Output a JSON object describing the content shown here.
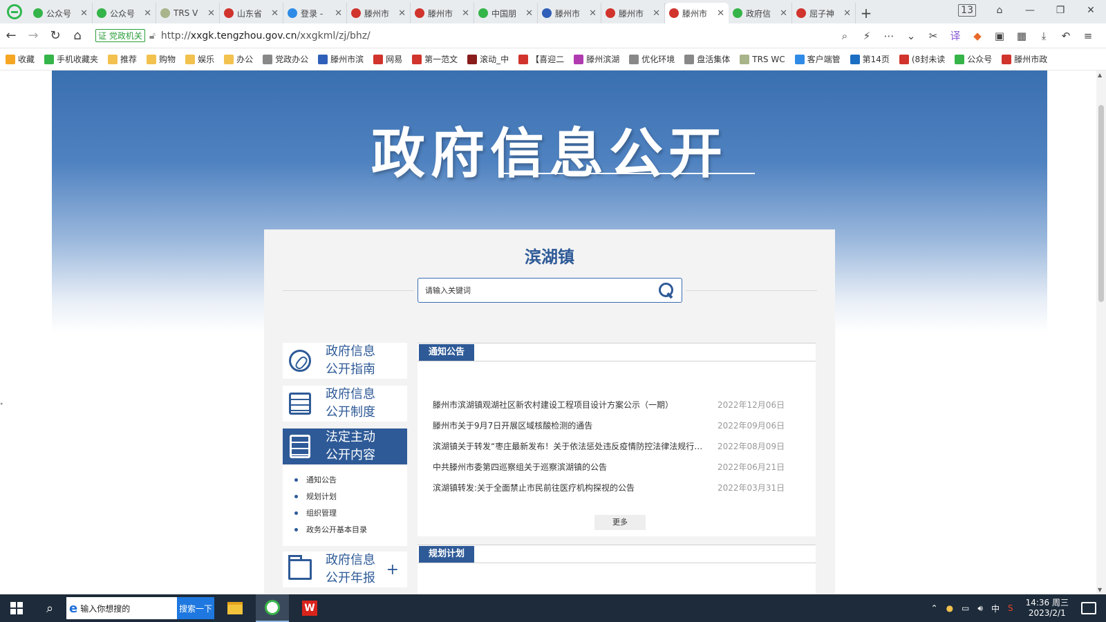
{
  "browser": {
    "tabs": [
      {
        "label": "公众号",
        "color": "#35b449"
      },
      {
        "label": "公众号",
        "color": "#35b449"
      },
      {
        "label": "TRS V",
        "color": "#a8b48a"
      },
      {
        "label": "山东省",
        "color": "#d0342c"
      },
      {
        "label": "登录 -",
        "color": "#2f8be6"
      },
      {
        "label": "滕州市",
        "color": "#d0342c"
      },
      {
        "label": "滕州市",
        "color": "#d0342c"
      },
      {
        "label": "中国朋",
        "color": "#35b449"
      },
      {
        "label": "滕州市",
        "color": "#2f5fb8"
      },
      {
        "label": "滕州市",
        "color": "#d0342c"
      },
      {
        "label": "滕州市",
        "color": "#d0342c"
      },
      {
        "label": "政府信",
        "color": "#35b449"
      },
      {
        "label": "屈子神",
        "color": "#d0342c"
      }
    ],
    "active_tab_index": 10,
    "tab_count": "13",
    "new_tab": "+",
    "address": {
      "badge": "证 党政机关",
      "url_prefix": "http://",
      "url_host": "xxgk.tengzhou.gov.cn",
      "url_path": "/xxgkml/zj/bhz/"
    },
    "bookmarks": [
      {
        "label": "收藏",
        "color": "#f5a623"
      },
      {
        "label": "手机收藏夹",
        "color": "#35b449"
      },
      {
        "label": "推荐",
        "color": "#f2c14e"
      },
      {
        "label": "购物",
        "color": "#f2c14e"
      },
      {
        "label": "娱乐",
        "color": "#f2c14e"
      },
      {
        "label": "办公",
        "color": "#f2c14e"
      },
      {
        "label": "党政办公",
        "color": "#888888"
      },
      {
        "label": "滕州市滨",
        "color": "#2f5fb8"
      },
      {
        "label": "网易",
        "color": "#d0342c"
      },
      {
        "label": "第一范文",
        "color": "#d0342c"
      },
      {
        "label": "滚动_中",
        "color": "#8a1c1c"
      },
      {
        "label": "【喜迎二",
        "color": "#d0342c"
      },
      {
        "label": "滕州滨湖",
        "color": "#b03ab0"
      },
      {
        "label": "优化环境",
        "color": "#888888"
      },
      {
        "label": "盘活集体",
        "color": "#888888"
      },
      {
        "label": "TRS WC",
        "color": "#a8b48a"
      },
      {
        "label": "客户端管",
        "color": "#2f8be6"
      },
      {
        "label": "第14页",
        "color": "#1b6ec2"
      },
      {
        "label": "(8封未读",
        "color": "#d0342c"
      },
      {
        "label": "公众号",
        "color": "#35b449"
      },
      {
        "label": "滕州市政",
        "color": "#d0342c"
      }
    ]
  },
  "page": {
    "banner_title": "政府信息公开",
    "town_title": "滨湖镇",
    "search_placeholder": "请输入关键词",
    "menu": [
      {
        "line1": "政府信息",
        "line2": "公开指南",
        "icon": "compass-icon"
      },
      {
        "line1": "政府信息",
        "line2": "公开制度",
        "icon": "list-icon"
      },
      {
        "line1": "法定主动",
        "line2": "公开内容",
        "icon": "document-icon"
      },
      {
        "line1": "政府信息",
        "line2": "公开年报",
        "icon": "folder-icon"
      }
    ],
    "active_menu_index": 2,
    "submenu": [
      "通知公告",
      "规划计划",
      "组织管理",
      "政务公开基本目录"
    ],
    "notice_panel": {
      "title": "通知公告",
      "items": [
        {
          "title": "滕州市滨湖镇观湖社区新农村建设工程项目设计方案公示（一期）",
          "date": "2022年12月06日"
        },
        {
          "title": "滕州市关于9月7日开展区域核酸检测的通告",
          "date": "2022年09月06日"
        },
        {
          "title": "滨湖镇关于转发“枣庄最新发布！关于依法惩处违反疫情防控法律法规行为的通告”",
          "date": "2022年08月09日"
        },
        {
          "title": "中共滕州市委第四巡察组关于巡察滨湖镇的公告",
          "date": "2022年06月21日"
        },
        {
          "title": "滨湖镇转发:关于全面禁止市民前往医疗机构探视的公告",
          "date": "2022年03月31日"
        }
      ],
      "more_label": "更多"
    },
    "plan_panel": {
      "title": "规划计划"
    }
  },
  "taskbar": {
    "search_input": "输入你想搜的",
    "search_button": "搜索一下",
    "ime": "中",
    "time": "14:36 周三",
    "date": "2023/2/1"
  },
  "colors": {
    "brand": "#2e5a97",
    "banner": "#3a6fb0"
  }
}
